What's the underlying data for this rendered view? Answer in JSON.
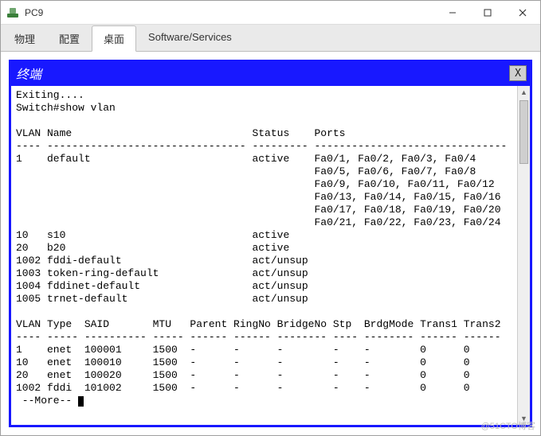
{
  "window": {
    "title": "PC9"
  },
  "tabs": {
    "t0": "物理",
    "t1": "配置",
    "t2": "桌面",
    "t3": "Software/Services"
  },
  "terminal": {
    "title": "终端",
    "close": "X",
    "line_exit": "Exiting....",
    "line_prompt": "Switch#show vlan",
    "hdr_vlan_name": "VLAN Name                             Status    Ports",
    "hdr_dash1": "---- -------------------------------- --------- -------------------------------",
    "v1": "1    default                          active    Fa0/1, Fa0/2, Fa0/3, Fa0/4",
    "v1b": "                                                Fa0/5, Fa0/6, Fa0/7, Fa0/8",
    "v1c": "                                                Fa0/9, Fa0/10, Fa0/11, Fa0/12",
    "v1d": "                                                Fa0/13, Fa0/14, Fa0/15, Fa0/16",
    "v1e": "                                                Fa0/17, Fa0/18, Fa0/19, Fa0/20",
    "v1f": "                                                Fa0/21, Fa0/22, Fa0/23, Fa0/24",
    "v10": "10   s10                              active",
    "v20": "20   b20                              active",
    "v1002": "1002 fddi-default                     act/unsup",
    "v1003": "1003 token-ring-default               act/unsup",
    "v1004": "1004 fddinet-default                  act/unsup",
    "v1005": "1005 trnet-default                    act/unsup",
    "hdr2": "VLAN Type  SAID       MTU   Parent RingNo BridgeNo Stp  BrdgMode Trans1 Trans2",
    "hdr_dash2": "---- ----- ---------- ----- ------ ------ -------- ---- -------- ------ ------",
    "r1": "1    enet  100001     1500  -      -      -        -    -        0      0",
    "r10": "10   enet  100010     1500  -      -      -        -    -        0      0",
    "r20": "20   enet  100020     1500  -      -      -        -    -        0      0",
    "r1002": "1002 fddi  101002     1500  -      -      -        -    -        0      0",
    "more": " --More-- "
  },
  "watermark": "@51CTO博客"
}
